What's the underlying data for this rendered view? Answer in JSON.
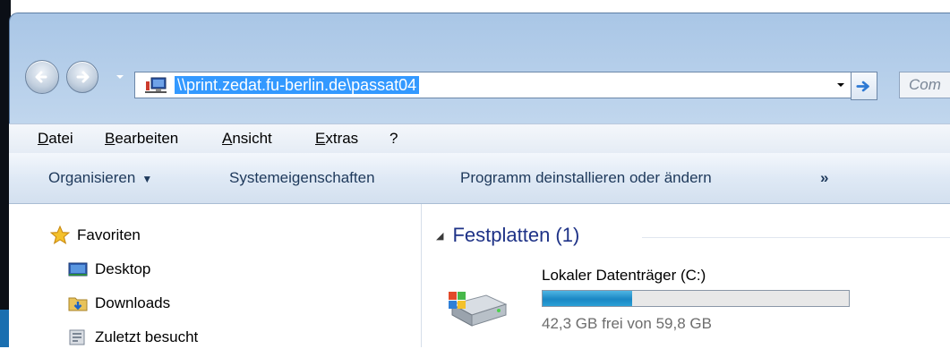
{
  "address_bar": {
    "path": "\\\\print.zedat.fu-berlin.de\\passat04"
  },
  "search": {
    "placeholder": "Com"
  },
  "menu": {
    "items": [
      {
        "label": "Datei"
      },
      {
        "label": "Bearbeiten"
      },
      {
        "label": "Ansicht"
      },
      {
        "label": "Extras"
      },
      {
        "label": "?"
      }
    ]
  },
  "toolbar": {
    "organize_label": "Organisieren",
    "system_properties_label": "Systemeigenschaften",
    "uninstall_label": "Programm deinstallieren oder ändern",
    "more_label": "»"
  },
  "nav_pane": {
    "favorites_label": "Favoriten",
    "items": [
      {
        "label": "Desktop",
        "icon": "desktop-icon"
      },
      {
        "label": "Downloads",
        "icon": "downloads-folder-icon"
      },
      {
        "label": "Zuletzt besucht",
        "icon": "recent-places-icon"
      }
    ]
  },
  "content": {
    "group_title": "Festplatten (1)",
    "drives": [
      {
        "name": "Lokaler Datenträger (C:)",
        "free_text": "42,3 GB frei von 59,8 GB",
        "used_fraction": 0.293
      }
    ]
  },
  "colors": {
    "selection": "#3399ff",
    "group_title": "#1e3287",
    "toolbar_text": "#1e395b",
    "drive_bar": "#1a87c4"
  }
}
